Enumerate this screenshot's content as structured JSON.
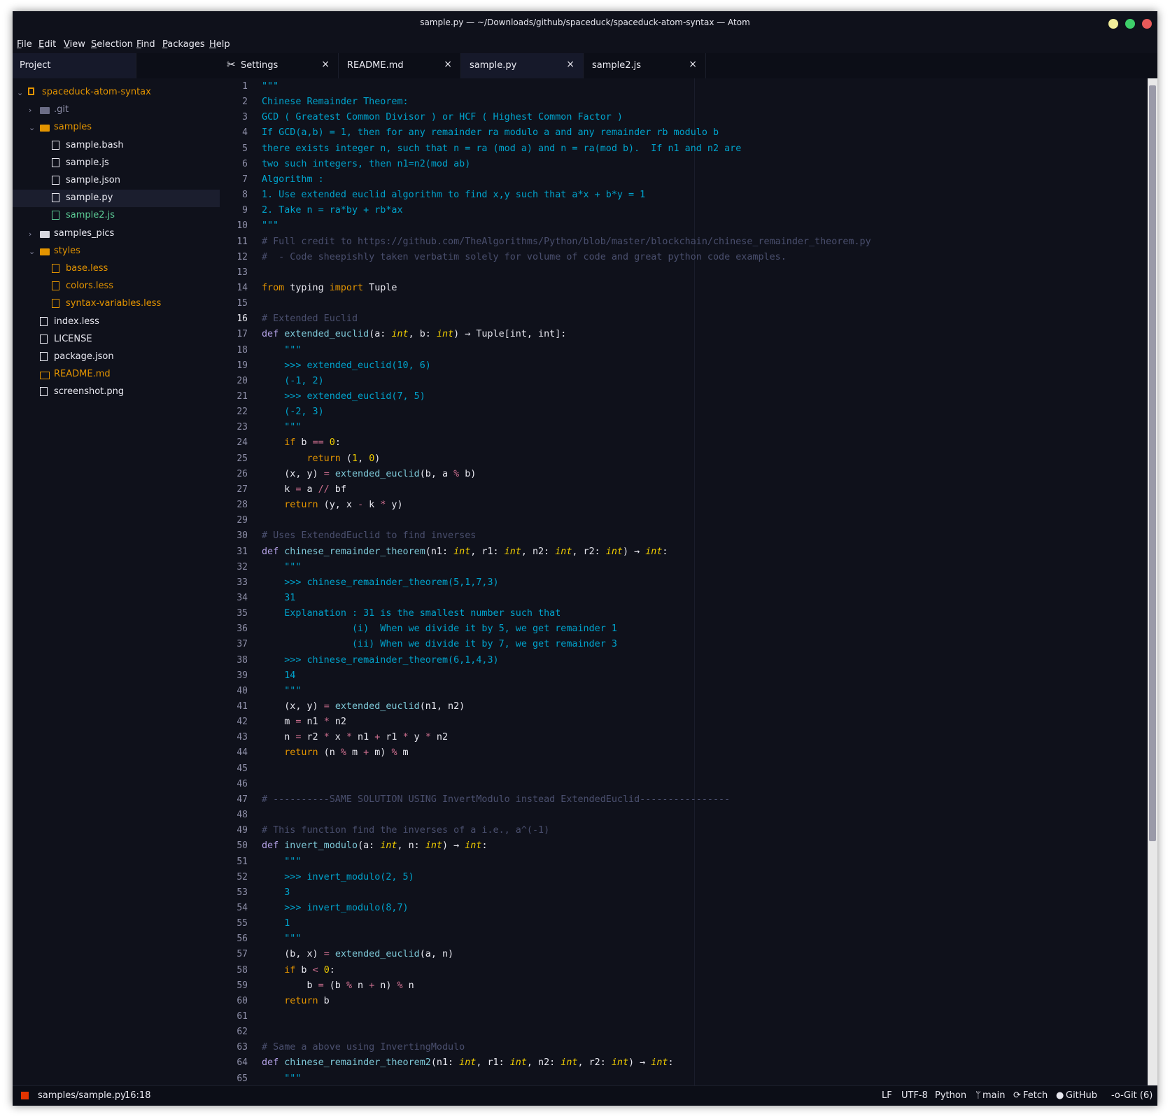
{
  "window": {
    "title": "sample.py — ~/Downloads/github/spaceduck/spaceduck-atom-syntax — Atom"
  },
  "menu": [
    "File",
    "Edit",
    "View",
    "Selection",
    "Find",
    "Packages",
    "Help"
  ],
  "project_tab": "Project",
  "tabs": [
    {
      "label": "Settings",
      "close": "×"
    },
    {
      "label": "README.md",
      "close": "×"
    },
    {
      "label": "sample.py",
      "close": "×"
    },
    {
      "label": "sample2.js",
      "close": "×"
    }
  ],
  "tree": [
    {
      "label": "spaceduck-atom-syntax",
      "depth": 0,
      "kind": "repo",
      "open": true,
      "color": "#e39400"
    },
    {
      "label": ".git",
      "depth": 1,
      "kind": "folder",
      "open": false,
      "color": "#8e8fa8"
    },
    {
      "label": "samples",
      "depth": 1,
      "kind": "folder",
      "open": true,
      "color": "#e39400"
    },
    {
      "label": "sample.bash",
      "depth": 2,
      "kind": "file",
      "color": "#e8e8f0"
    },
    {
      "label": "sample.js",
      "depth": 2,
      "kind": "file",
      "color": "#e8e8f0"
    },
    {
      "label": "sample.json",
      "depth": 2,
      "kind": "file",
      "color": "#e8e8f0"
    },
    {
      "label": "sample.py",
      "depth": 2,
      "kind": "file",
      "color": "#e8e8f0",
      "selected": true
    },
    {
      "label": "sample2.js",
      "depth": 2,
      "kind": "file",
      "color": "#5ccc96"
    },
    {
      "label": "samples_pics",
      "depth": 1,
      "kind": "folder",
      "open": false,
      "color": "#e8e8f0"
    },
    {
      "label": "styles",
      "depth": 1,
      "kind": "folder",
      "open": true,
      "color": "#e39400"
    },
    {
      "label": "base.less",
      "depth": 2,
      "kind": "file",
      "color": "#e39400"
    },
    {
      "label": "colors.less",
      "depth": 2,
      "kind": "file",
      "color": "#e39400"
    },
    {
      "label": "syntax-variables.less",
      "depth": 2,
      "kind": "file",
      "color": "#e39400"
    },
    {
      "label": "index.less",
      "depth": 1,
      "kind": "file",
      "color": "#e8e8f0"
    },
    {
      "label": "LICENSE",
      "depth": 1,
      "kind": "file",
      "color": "#e8e8f0"
    },
    {
      "label": "package.json",
      "depth": 1,
      "kind": "file",
      "color": "#e8e8f0"
    },
    {
      "label": "README.md",
      "depth": 1,
      "kind": "book",
      "color": "#e39400"
    },
    {
      "label": "screenshot.png",
      "depth": 1,
      "kind": "image",
      "color": "#e8e8f0"
    }
  ],
  "code_lines": [
    [
      [
        "s",
        "\"\"\""
      ]
    ],
    [
      [
        "s",
        "Chinese Remainder Theorem:"
      ]
    ],
    [
      [
        "s",
        "GCD ( Greatest Common Divisor ) or HCF ( Highest Common Factor )"
      ]
    ],
    [
      [
        "s",
        "If GCD(a,b) = 1, then for any remainder ra modulo a and any remainder rb modulo b"
      ]
    ],
    [
      [
        "s",
        "there exists integer n, such that n = ra (mod a) and n = ra(mod b).  If n1 and n2 are"
      ]
    ],
    [
      [
        "s",
        "two such integers, then n1=n2(mod ab)"
      ]
    ],
    [
      [
        "s",
        "Algorithm :"
      ]
    ],
    [
      [
        "s",
        "1. Use extended euclid algorithm to find x,y such that a*x + b*y = 1"
      ]
    ],
    [
      [
        "s",
        "2. Take n = ra*by + rb*ax"
      ]
    ],
    [
      [
        "s",
        "\"\"\""
      ]
    ],
    [
      [
        "c",
        "# Full credit to https://github.com/TheAlgorithms/Python/blob/master/blockchain/chinese_remainder_theorem.py"
      ]
    ],
    [
      [
        "c",
        "#  - Code sheepishly taken verbatim solely for volume of code and great python code examples."
      ]
    ],
    [],
    [
      [
        "n",
        "from"
      ],
      [
        "p",
        " typing "
      ],
      [
        "n",
        "import"
      ],
      [
        "p",
        " Tuple"
      ]
    ],
    [],
    [
      [
        "c",
        "# Extended Euclid"
      ]
    ],
    [
      [
        "k",
        "def"
      ],
      [
        "p",
        " "
      ],
      [
        "f",
        "extended_euclid"
      ],
      [
        "p",
        "(a: "
      ],
      [
        "t",
        "int"
      ],
      [
        "p",
        ", b: "
      ],
      [
        "t",
        "int"
      ],
      [
        "p",
        ") → Tuple[int, int]:"
      ]
    ],
    [
      [
        "s",
        "    \"\"\""
      ]
    ],
    [
      [
        "s",
        "    >>> extended_euclid(10, 6)"
      ]
    ],
    [
      [
        "s",
        "    (-1, 2)"
      ]
    ],
    [
      [
        "s",
        "    >>> extended_euclid(7, 5)"
      ]
    ],
    [
      [
        "s",
        "    (-2, 3)"
      ]
    ],
    [
      [
        "s",
        "    \"\"\""
      ]
    ],
    [
      [
        "p",
        "    "
      ],
      [
        "n",
        "if"
      ],
      [
        "p",
        " b "
      ],
      [
        "op",
        "=="
      ],
      [
        "p",
        " "
      ],
      [
        "o",
        "0"
      ],
      [
        "p",
        ":"
      ]
    ],
    [
      [
        "p",
        "        "
      ],
      [
        "n",
        "return"
      ],
      [
        "p",
        " ("
      ],
      [
        "o",
        "1"
      ],
      [
        "p",
        ", "
      ],
      [
        "o",
        "0"
      ],
      [
        "p",
        ")"
      ]
    ],
    [
      [
        "p",
        "    (x, y) "
      ],
      [
        "op",
        "="
      ],
      [
        "p",
        " "
      ],
      [
        "f",
        "extended_euclid"
      ],
      [
        "p",
        "(b, a "
      ],
      [
        "op",
        "%"
      ],
      [
        "p",
        " b)"
      ]
    ],
    [
      [
        "p",
        "    k "
      ],
      [
        "op",
        "="
      ],
      [
        "p",
        " a "
      ],
      [
        "op",
        "//"
      ],
      [
        "p",
        " bf"
      ]
    ],
    [
      [
        "p",
        "    "
      ],
      [
        "n",
        "return"
      ],
      [
        "p",
        " (y, x "
      ],
      [
        "op",
        "-"
      ],
      [
        "p",
        " k "
      ],
      [
        "op",
        "*"
      ],
      [
        "p",
        " y)"
      ]
    ],
    [],
    [
      [
        "c",
        "# Uses ExtendedEuclid to find inverses"
      ]
    ],
    [
      [
        "k",
        "def"
      ],
      [
        "p",
        " "
      ],
      [
        "f",
        "chinese_remainder_theorem"
      ],
      [
        "p",
        "(n1: "
      ],
      [
        "t",
        "int"
      ],
      [
        "p",
        ", r1: "
      ],
      [
        "t",
        "int"
      ],
      [
        "p",
        ", n2: "
      ],
      [
        "t",
        "int"
      ],
      [
        "p",
        ", r2: "
      ],
      [
        "t",
        "int"
      ],
      [
        "p",
        ") → "
      ],
      [
        "t",
        "int"
      ],
      [
        "p",
        ":"
      ]
    ],
    [
      [
        "s",
        "    \"\"\""
      ]
    ],
    [
      [
        "s",
        "    >>> chinese_remainder_theorem(5,1,7,3)"
      ]
    ],
    [
      [
        "s",
        "    31"
      ]
    ],
    [
      [
        "s",
        "    Explanation : 31 is the smallest number such that"
      ]
    ],
    [
      [
        "s",
        "                (i)  When we divide it by 5, we get remainder 1"
      ]
    ],
    [
      [
        "s",
        "                (ii) When we divide it by 7, we get remainder 3"
      ]
    ],
    [
      [
        "s",
        "    >>> chinese_remainder_theorem(6,1,4,3)"
      ]
    ],
    [
      [
        "s",
        "    14"
      ]
    ],
    [
      [
        "s",
        "    \"\"\""
      ]
    ],
    [
      [
        "p",
        "    (x, y) "
      ],
      [
        "op",
        "="
      ],
      [
        "p",
        " "
      ],
      [
        "f",
        "extended_euclid"
      ],
      [
        "p",
        "(n1, n2)"
      ]
    ],
    [
      [
        "p",
        "    m "
      ],
      [
        "op",
        "="
      ],
      [
        "p",
        " n1 "
      ],
      [
        "op",
        "*"
      ],
      [
        "p",
        " n2"
      ]
    ],
    [
      [
        "p",
        "    n "
      ],
      [
        "op",
        "="
      ],
      [
        "p",
        " r2 "
      ],
      [
        "op",
        "*"
      ],
      [
        "p",
        " x "
      ],
      [
        "op",
        "*"
      ],
      [
        "p",
        " n1 "
      ],
      [
        "op",
        "+"
      ],
      [
        "p",
        " r1 "
      ],
      [
        "op",
        "*"
      ],
      [
        "p",
        " y "
      ],
      [
        "op",
        "*"
      ],
      [
        "p",
        " n2"
      ]
    ],
    [
      [
        "p",
        "    "
      ],
      [
        "n",
        "return"
      ],
      [
        "p",
        " (n "
      ],
      [
        "op",
        "%"
      ],
      [
        "p",
        " m "
      ],
      [
        "op",
        "+"
      ],
      [
        "p",
        " m) "
      ],
      [
        "op",
        "%"
      ],
      [
        "p",
        " m"
      ]
    ],
    [],
    [],
    [
      [
        "c",
        "# ----------SAME SOLUTION USING InvertModulo instead ExtendedEuclid----------------"
      ]
    ],
    [],
    [
      [
        "c",
        "# This function find the inverses of a i.e., a^(-1)"
      ]
    ],
    [
      [
        "k",
        "def"
      ],
      [
        "p",
        " "
      ],
      [
        "f",
        "invert_modulo"
      ],
      [
        "p",
        "(a: "
      ],
      [
        "t",
        "int"
      ],
      [
        "p",
        ", n: "
      ],
      [
        "t",
        "int"
      ],
      [
        "p",
        ") → "
      ],
      [
        "t",
        "int"
      ],
      [
        "p",
        ":"
      ]
    ],
    [
      [
        "s",
        "    \"\"\""
      ]
    ],
    [
      [
        "s",
        "    >>> invert_modulo(2, 5)"
      ]
    ],
    [
      [
        "s",
        "    3"
      ]
    ],
    [
      [
        "s",
        "    >>> invert_modulo(8,7)"
      ]
    ],
    [
      [
        "s",
        "    1"
      ]
    ],
    [
      [
        "s",
        "    \"\"\""
      ]
    ],
    [
      [
        "p",
        "    (b, x) "
      ],
      [
        "op",
        "="
      ],
      [
        "p",
        " "
      ],
      [
        "f",
        "extended_euclid"
      ],
      [
        "p",
        "(a, n)"
      ]
    ],
    [
      [
        "p",
        "    "
      ],
      [
        "n",
        "if"
      ],
      [
        "p",
        " b "
      ],
      [
        "op",
        "<"
      ],
      [
        "p",
        " "
      ],
      [
        "o",
        "0"
      ],
      [
        "p",
        ":"
      ]
    ],
    [
      [
        "p",
        "        b "
      ],
      [
        "op",
        "="
      ],
      [
        "p",
        " (b "
      ],
      [
        "op",
        "%"
      ],
      [
        "p",
        " n "
      ],
      [
        "op",
        "+"
      ],
      [
        "p",
        " n) "
      ],
      [
        "op",
        "%"
      ],
      [
        "p",
        " n"
      ]
    ],
    [
      [
        "p",
        "    "
      ],
      [
        "n",
        "return"
      ],
      [
        "p",
        " b"
      ]
    ],
    [],
    [],
    [
      [
        "c",
        "# Same a above using InvertingModulo"
      ]
    ],
    [
      [
        "k",
        "def"
      ],
      [
        "p",
        " "
      ],
      [
        "f",
        "chinese_remainder_theorem2"
      ],
      [
        "p",
        "(n1: "
      ],
      [
        "t",
        "int"
      ],
      [
        "p",
        ", r1: "
      ],
      [
        "t",
        "int"
      ],
      [
        "p",
        ", n2: "
      ],
      [
        "t",
        "int"
      ],
      [
        "p",
        ", r2: "
      ],
      [
        "t",
        "int"
      ],
      [
        "p",
        ") → "
      ],
      [
        "t",
        "int"
      ],
      [
        "p",
        ":"
      ]
    ],
    [
      [
        "s",
        "    \"\"\""
      ]
    ]
  ],
  "active_line": 16,
  "status": {
    "path": "samples/sample.py",
    "cursor": "16:18",
    "line_ending": "LF",
    "encoding": "UTF-8",
    "grammar": "Python",
    "branch": "main",
    "fetch": "Fetch",
    "github": "GitHub",
    "git": "Git (6)"
  },
  "colors": {
    "background": "#0f111b",
    "foreground": "#e8e8f0",
    "string": "#00a3cc",
    "comment": "#4a4f6e",
    "keyword": "#b3a1e6",
    "function": "#7ec9d8",
    "number": "#f2ce00",
    "operator": "#ce6f8f",
    "control": "#e39400"
  }
}
